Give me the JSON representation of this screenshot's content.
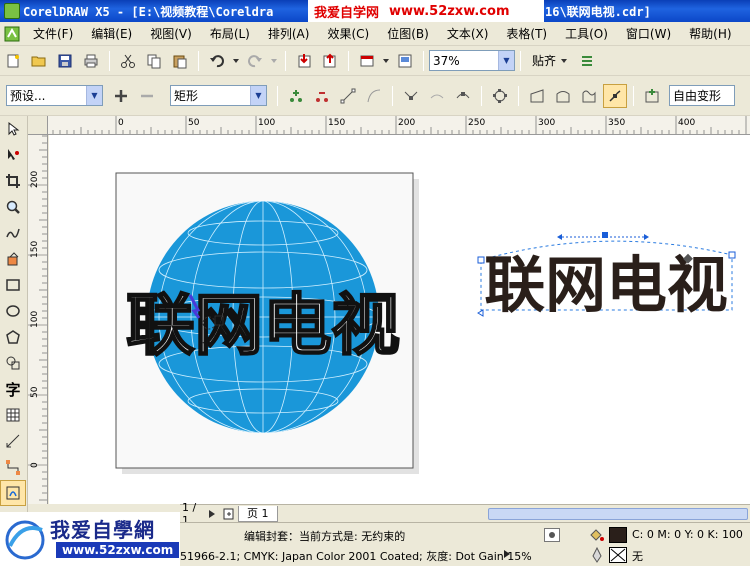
{
  "titlebar": {
    "left": "CorelDRAW X5 - [E:\\视频教程\\Coreldra",
    "watermark_cn": "我爱自学网",
    "watermark_url": "www.52zxw.com",
    "right": "16\\联网电视.cdr]"
  },
  "menu": [
    "文件(F)",
    "编辑(E)",
    "视图(V)",
    "布局(L)",
    "排列(A)",
    "效果(C)",
    "位图(B)",
    "文本(X)",
    "表格(T)",
    "工具(O)",
    "窗口(W)",
    "帮助(H)"
  ],
  "toolbar": {
    "zoom_value": "37%",
    "snap_label": "贴齐"
  },
  "propbar": {
    "preset_value": "预设...",
    "shape_value": "矩形",
    "mode_value": "自由变形"
  },
  "hruler_ticks": [
    "0",
    "50",
    "100",
    "150",
    "200",
    "250",
    "300",
    "350",
    "400"
  ],
  "vruler_ticks": [
    "200",
    "150",
    "100",
    "50",
    "0"
  ],
  "artwork": {
    "text": "联网电视",
    "globe_color": "#1a97d9",
    "text_color": "#2a1f1a"
  },
  "pagebar": {
    "counter": "1 / 1",
    "page_label": "页 1"
  },
  "status": {
    "message": "编辑封套：当前方式是: 无约束的",
    "color_profile": "51966-2.1; CMYK: Japan Color 2001 Coated; 灰度: Dot Gain 15%",
    "fill_value": "C: 0 M: 0 Y: 0 K: 100",
    "outline_value": "无"
  },
  "logo": {
    "cn": "我爱自學網",
    "url": "www.52zxw.com"
  }
}
